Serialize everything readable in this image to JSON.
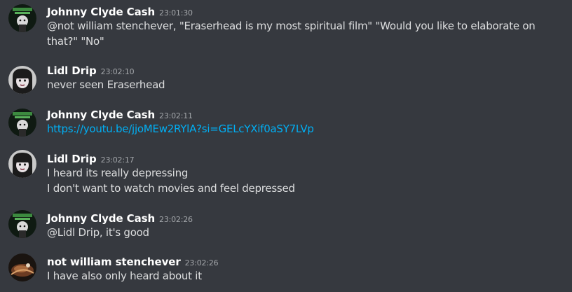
{
  "colors": {
    "background": "#36393f",
    "username": "#ffffff",
    "text": "#dcddde",
    "timestamp": "#a3a6aa",
    "link": "#00aff4"
  },
  "messages": [
    {
      "author": "Johnny Clyde Cash",
      "time": "23:01:30",
      "avatar_icon": "johnny-clyde-cash-avatar",
      "lines": [
        "@not william stenchever, \"Eraserhead is my most spiritual film\" \"Would you like to elaborate on that?\" \"No\""
      ]
    },
    {
      "author": "Lidl Drip",
      "time": "23:02:10",
      "avatar_icon": "lidl-drip-avatar",
      "lines": [
        "never seen Eraserhead"
      ]
    },
    {
      "author": "Johnny Clyde Cash",
      "time": "23:02:11",
      "avatar_icon": "johnny-clyde-cash-avatar",
      "link": "https://youtu.be/jjoMEw2RYlA?si=GELcYXif0aSY7LVp"
    },
    {
      "author": "Lidl Drip",
      "time": "23:02:17",
      "avatar_icon": "lidl-drip-avatar",
      "lines": [
        "I heard its really depressing",
        "I don't want to watch movies and feel depressed"
      ]
    },
    {
      "author": "Johnny Clyde Cash",
      "time": "23:02:26",
      "avatar_icon": "johnny-clyde-cash-avatar",
      "lines": [
        "@Lidl Drip, it's good"
      ]
    },
    {
      "author": "not william stenchever",
      "time": "23:02:26",
      "avatar_icon": "not-william-stenchever-avatar",
      "lines": [
        "I have also only heard about it"
      ]
    }
  ]
}
